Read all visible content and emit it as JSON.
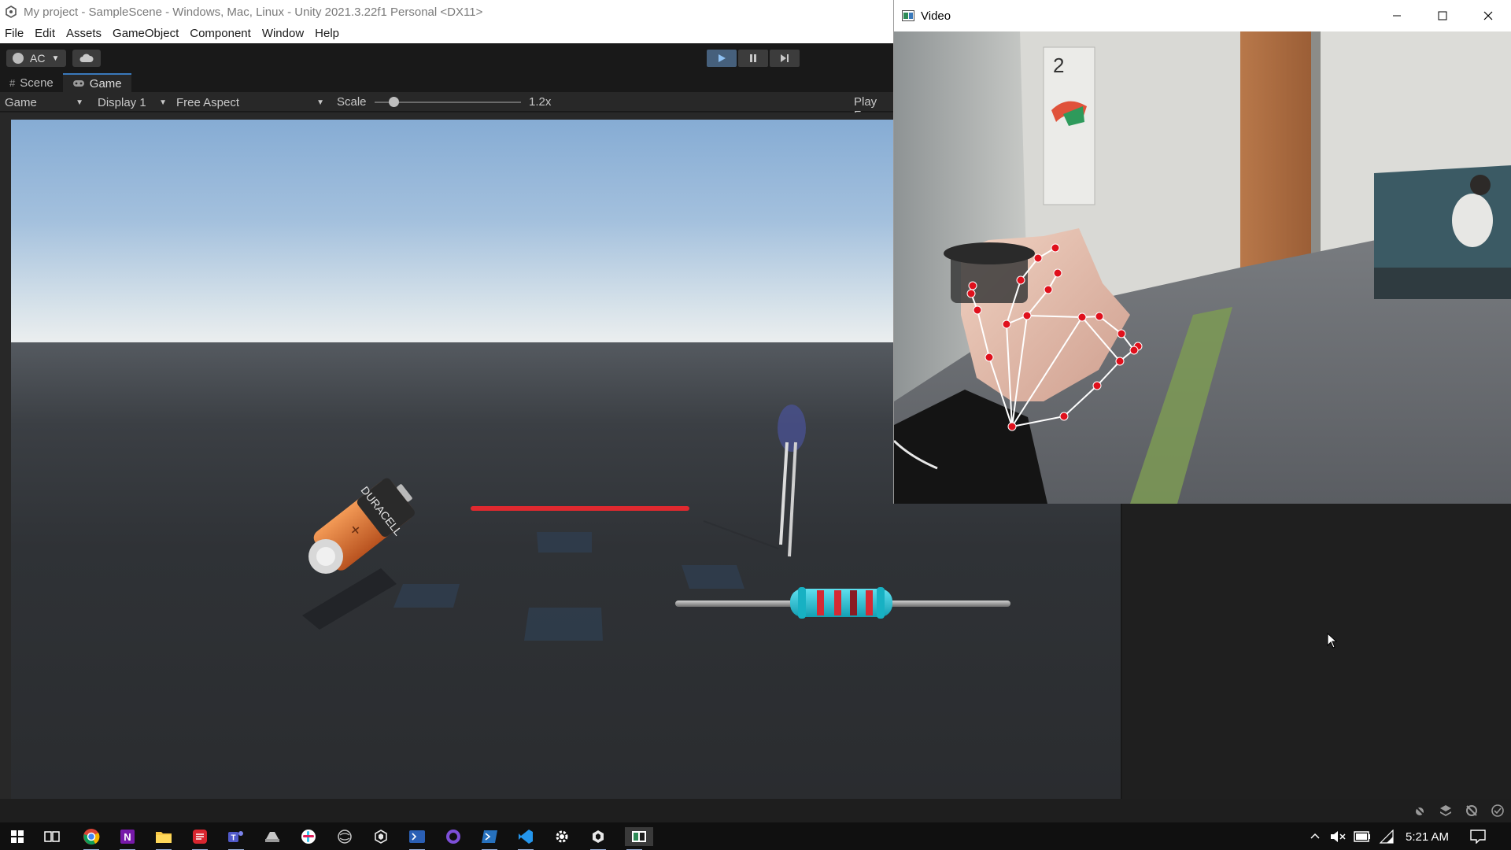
{
  "unity": {
    "title": "My project - SampleScene - Windows, Mac, Linux - Unity 2021.3.22f1 Personal <DX11>",
    "menu": [
      "File",
      "Edit",
      "Assets",
      "GameObject",
      "Component",
      "Window",
      "Help"
    ],
    "account_label": "AC",
    "tabs": [
      {
        "label": "Scene",
        "icon": "grid-icon",
        "active": false
      },
      {
        "label": "Game",
        "icon": "gamepad-icon",
        "active": true
      }
    ],
    "game_bar": {
      "game_mode": "Game",
      "display": "Display 1",
      "aspect": "Free Aspect",
      "scale_label": "Scale",
      "scale_value": "1.2x",
      "play_focus": "Play Fo"
    }
  },
  "video": {
    "title": "Video"
  },
  "taskbar": {
    "time": "5:21 AM",
    "apps": [
      "windows-start-icon",
      "task-view-icon",
      "chrome-icon",
      "onenote-icon",
      "file-explorer-icon",
      "red-app-icon",
      "teams-icon",
      "drive-icon",
      "slack-icon",
      "unity-hub-icon",
      "unity-icon",
      "terminal-icon",
      "github-icon",
      "powershell-icon",
      "vscode-icon",
      "settings-icon",
      "unity-editor-icon",
      "video-window-icon"
    ]
  },
  "colors": {
    "accent": "#3a79bb",
    "play_active": "#46607c",
    "landmark_red": "#e0101c"
  }
}
